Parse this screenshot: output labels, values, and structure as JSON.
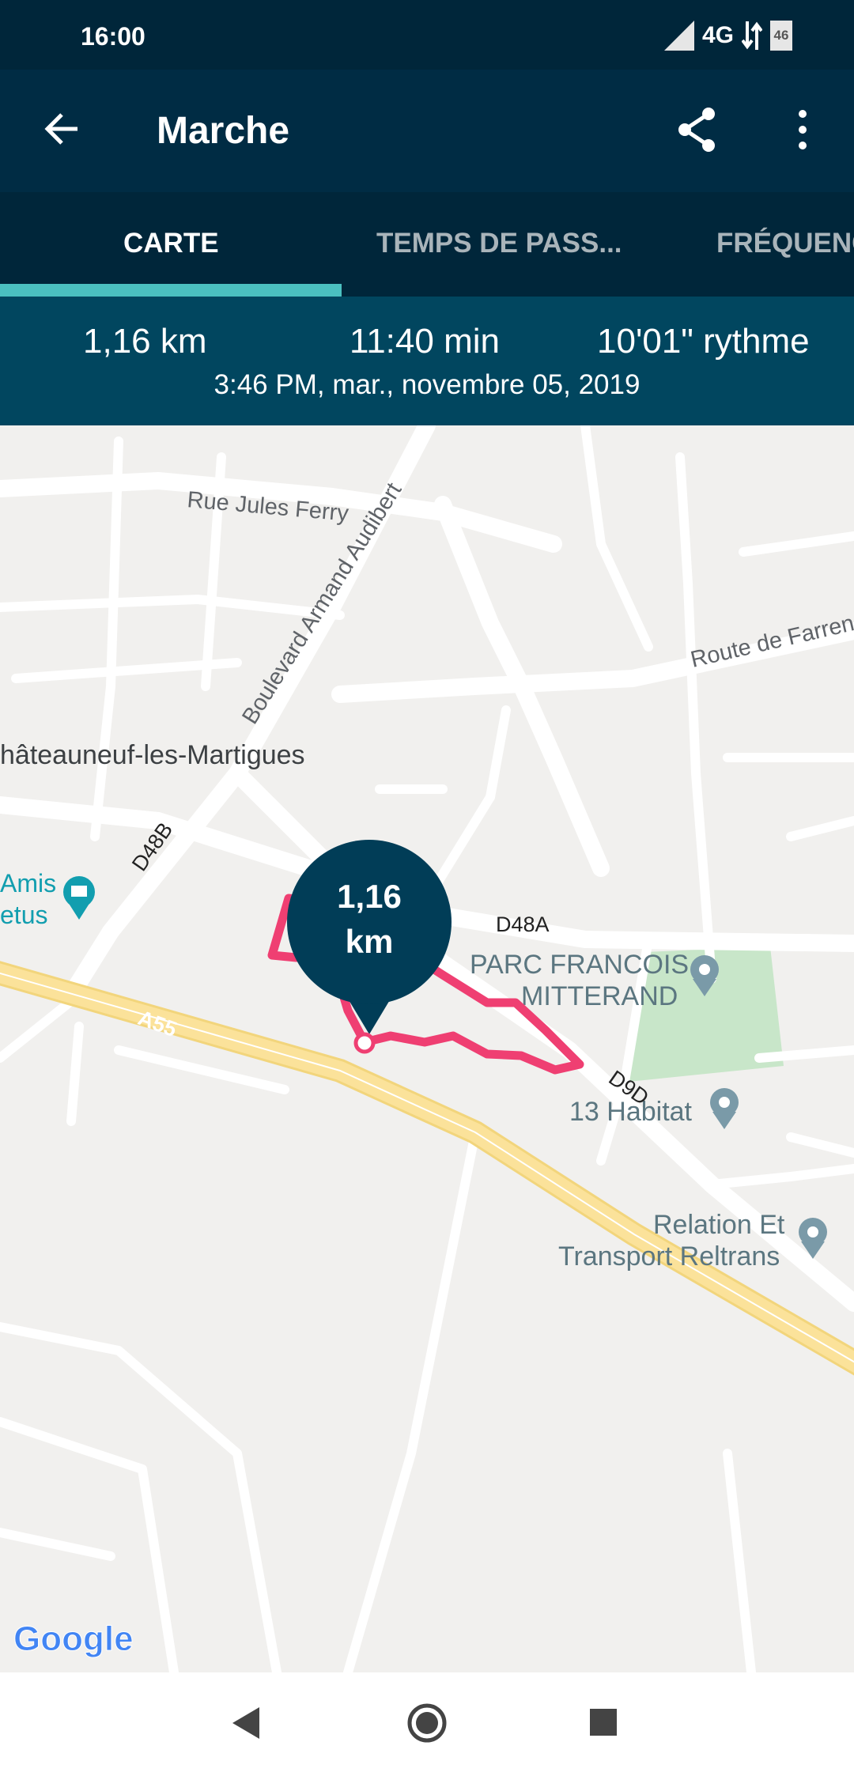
{
  "status_bar": {
    "time": "16:00",
    "network": "4G",
    "battery": "46"
  },
  "toolbar": {
    "title": "Marche"
  },
  "tabs": [
    {
      "label": "CARTE",
      "active": true
    },
    {
      "label": "TEMPS DE PASS..."
    },
    {
      "label": "FRÉQUENC"
    }
  ],
  "stats": {
    "distance": "1,16 km",
    "duration": "11:40 min",
    "pace": "10'01\" rythme",
    "datetime": "3:46 PM, mar., novembre 05, 2019"
  },
  "map": {
    "marker": {
      "value": "1,16",
      "unit": "km"
    },
    "labels": {
      "rue_jules_ferry": "Rue Jules Ferry",
      "boulevard": "Boulevard Armand Audibert",
      "route_farren": "Route de Farren",
      "town": "hâteauneuf-les-Martigues",
      "d48b": "D48B",
      "amis": "Amis",
      "etus": "etus",
      "d48a": "D48A",
      "parc1": "PARC FRANCOIS",
      "parc2": "MITTERAND",
      "habitat": "13 Habitat",
      "d9d": "D9D",
      "a55": "A55",
      "relation1": "Relation Et",
      "relation2": "Transport Reltrans"
    },
    "logo": "Google",
    "colors": {
      "route": "#ef3f72",
      "marker": "#013d57",
      "park": "#c8e6c9",
      "highway": "#fbe29a"
    }
  }
}
